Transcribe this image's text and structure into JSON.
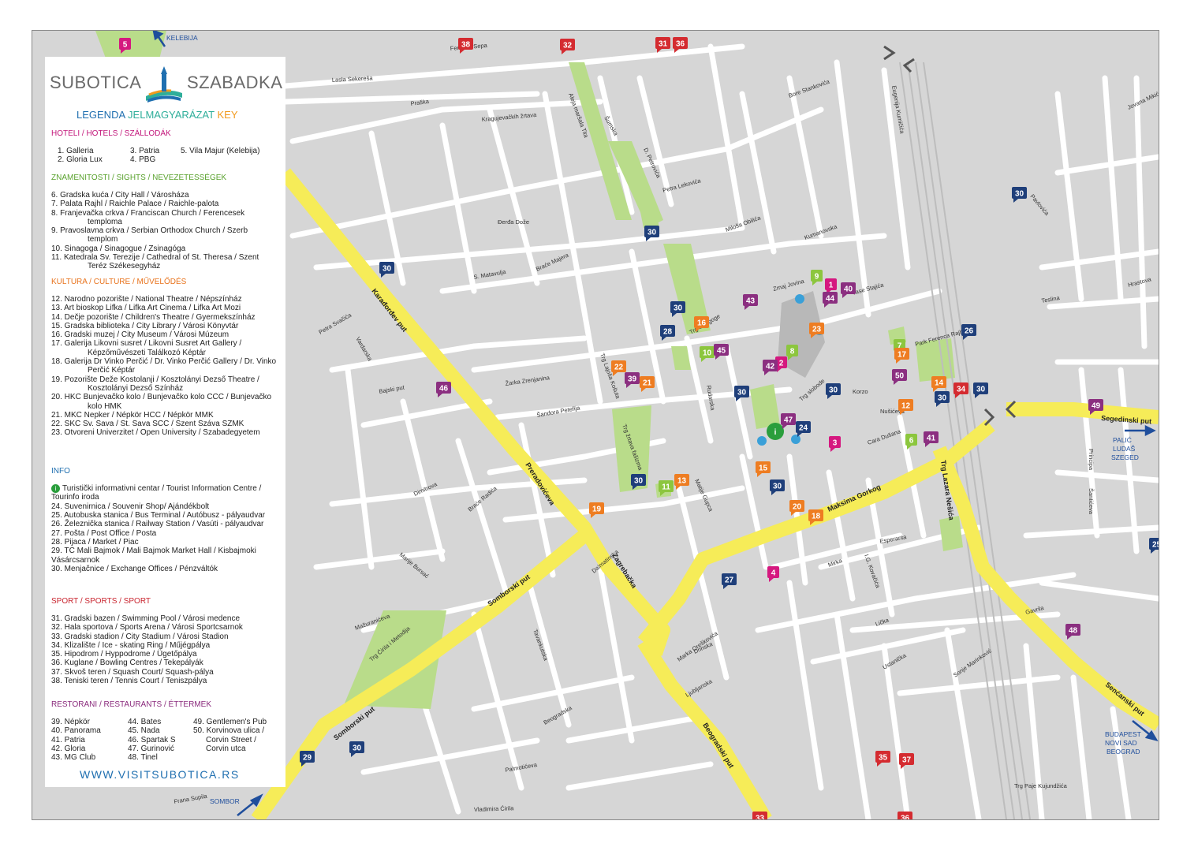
{
  "colors": {
    "road_main": "#f6ec58",
    "road_secondary": "#ffffff",
    "block": "#d6d6d6",
    "park": "#b9dc8a",
    "hotel": "#d5187f",
    "sight": "#8cc63e",
    "culture": "#ee7d22",
    "info": "#1f3f7a",
    "sport": "#d42b30",
    "restaurant": "#8b2f80"
  },
  "legend": {
    "logo_left": "SUBOTICA",
    "logo_right": "SZABADKA",
    "heading": {
      "a": "LEGENDA",
      "b": "JELMAGYARÁZAT",
      "c": "KEY"
    },
    "hotels_title": "HOTELI / HOTELS / SZÁLLODÁK",
    "hotels_col1": [
      "1. Galleria",
      "2. Gloria Lux"
    ],
    "hotels_col2": [
      "3. Patria",
      "4. PBG"
    ],
    "hotels_col3": [
      "5. Vila Majur (Kelebija)"
    ],
    "sights_title": "ZNAMENITOSTI / SIGHTS / NEVEZETESSÉGEK",
    "sights": [
      "6. Gradska kuća / City Hall / Városháza",
      "7. Palata Rajhl / Raichle Palace / Raichle-palota",
      "8. Franjevačka crkva / Franciscan Church / Ferencesek temploma",
      "9. Pravoslavna crkva / Serbian Orthodox Church / Szerb templom",
      "10. Sinagoga / Sinagogue / Zsinagóga",
      "11. Katedrala Sv. Terezije / Cathedral of St. Theresa / Szent Teréz Székesegyház"
    ],
    "culture_title": "KULTURA / CULTURE / MŰVELŐDÉS",
    "culture": [
      "12. Narodno pozorište / National Theatre / Népszínház",
      "13. Art bioskop Lifka / Lifka Art Cinema / Lifka Art Mozi",
      "14. Dečje pozorište / Children's Theatre / Gyermekszínház",
      "15. Gradska biblioteka / City Library / Városi Könyvtár",
      "16. Gradski muzej / City Museum / Városi Múzeum",
      "17. Galerija Likovni susret / Likovni Susret Art Gallery / Képzőművészeti Találkozó Képtár",
      "18. Galerija Dr Vinko Perčić / Dr. Vinko Perčić Gallery / Dr. Vinko Perčić Képtár",
      "19. Pozorište Deže Kostolanji / Kosztolányi Dezső Theatre / Kosztolányi Dezső Színház",
      "20. HKC Bunjevačko kolo / Bunjevačko kolo CCC / Bunjevačko kolo HMK",
      "21. MKC Nepker / Népkör HCC / Népkör MMK",
      "22. SKC Sv. Sava / St. Sava SCC / Szent Száva SZMK",
      "23. Otvoreni Univerzitet / Open University / Szabadegyetem"
    ],
    "info_title": "INFO",
    "info": [
      "Turistički informativni centar / Tourist Information Centre / Tourinfo iroda",
      "24. Suvenirnica / Souvenir Shop/ Ajándékbolt",
      "25. Autobuska stanica / Bus Terminal / Autóbusz - pályaudvar",
      "26. Železnička stanica / Railway Station / Vasúti - pályaudvar",
      "27. Pošta / Post Office / Posta",
      "28. Pijaca / Market / Piac",
      "29. TC Mali Bajmok / Mali Bajmok Market Hall / Kisbajmoki Vásárcsarnok",
      "30. Menjačnice / Exchange Offices / Pénzváltók"
    ],
    "sport_title": "SPORT / SPORTS / SPORT",
    "sport": [
      "31. Gradski bazen / Swimming Pool / Városi medence",
      "32. Hala sportova / Sports Arena / Városi Sportcsarnok",
      "33. Gradski stadion / City Stadium / Városi Stadion",
      "34. Klizalište / Ice - skating Ring / Műjégpálya",
      "35. Hipodrom / Hyppodrome / Ügetőpálya",
      "36. Kuglane / Bowling Centres / Tekepályák",
      "37. Skvoš teren / Squash Court/ Squash-pálya",
      "38. Teniski teren / Tennis Court / Teniszpálya"
    ],
    "rest_title": "RESTORANI / RESTAURANTS / ÉTTERMEK",
    "rest_col1": [
      "39. Népkör",
      "40. Panorama",
      "41. Patria",
      "42. Gloria",
      "43. MG Club"
    ],
    "rest_col2": [
      "44. Bates",
      "45. Nada",
      "46. Spartak S",
      "47. Gurinović",
      "48. Tinel"
    ],
    "rest_col3": [
      "49. Gentlemen's Pub",
      "50. Korvinova ulica /",
      "Corvin Street /",
      "Corvin utca"
    ],
    "website": "WWW.VISITSUBOTICA.RS"
  },
  "map": {
    "destinations": [
      "KELEBIJA",
      "SOMBOR",
      "PALIĆ",
      "LUDAŠ",
      "SZEGED",
      "BUDAPEST",
      "NOVI SAD",
      "BEOGRAD"
    ],
    "main_roads": [
      "Karađorđev put",
      "Preradovićeva",
      "Zagrebačka",
      "Somborski put",
      "Somborski put",
      "Beogradski put",
      "Maksima Gorkog",
      "Trg Lazara Nešića",
      "Senćanski put",
      "Segedinski put"
    ],
    "streets": [
      "Ferenca Sepa",
      "Lasla Sekereša",
      "Praška",
      "Kragujevačkih žrtava",
      "Aleja maršala Tita",
      "Šumska",
      "D. Petrovića",
      "Petra Lekovića",
      "Miloša Obilića",
      "Bore Stankovića",
      "Kumanovska",
      "Zmaj Jovina",
      "Vase Stajića",
      "Korzo",
      "Nušićeva",
      "Cara Dušana",
      "Đerđa Dože",
      "S. Matavulja",
      "Braće Majera",
      "Žarka Zrenjanina",
      "Šandora Petefija",
      "Petra Svačića",
      "Bajski put",
      "Vardarska",
      "Matije Gupca",
      "Drinska",
      "Marka Oreškovića",
      "Ljubljanska",
      "Ustanička",
      "Sonje Marinković",
      "Eugenija Kumičića",
      "Jovana Mikića",
      "Hrastova",
      "Teslina",
      "Šantićeva",
      "Principa",
      "Gavrila",
      "Lička",
      "Mirka",
      "Esperanta",
      "I.G. Kovačića",
      "Braće Radića",
      "Mažuranićeva",
      "Marije Bursać",
      "Beogradska",
      "Palmotićeva",
      "Vladimira Ćirila",
      "Frana Supila",
      "Trg Ćirila i Metodija",
      "Trg slobode",
      "Trg žrtava fašizma",
      "Trg Lajoša Košuta",
      "Trg sinagoge",
      "Park Ferenca Rajhla",
      "Trg Paje Kujundžića",
      "Pavlovića",
      "Rudarska",
      "Dimitrova",
      "Tavankutska",
      "Dalmatinska"
    ],
    "markers": [
      {
        "n": "5",
        "c": "hotel"
      },
      {
        "n": "38",
        "c": "sport"
      },
      {
        "n": "32",
        "c": "sport"
      },
      {
        "n": "31",
        "c": "sport"
      },
      {
        "n": "36",
        "c": "sport"
      },
      {
        "n": "30",
        "c": "info"
      },
      {
        "n": "30",
        "c": "info"
      },
      {
        "n": "30",
        "c": "info"
      },
      {
        "n": "28",
        "c": "info"
      },
      {
        "n": "16",
        "c": "culture"
      },
      {
        "n": "10",
        "c": "sight"
      },
      {
        "n": "45",
        "c": "restaurant"
      },
      {
        "n": "43",
        "c": "restaurant"
      },
      {
        "n": "9",
        "c": "sight"
      },
      {
        "n": "1",
        "c": "hotel"
      },
      {
        "n": "40",
        "c": "restaurant"
      },
      {
        "n": "44",
        "c": "restaurant"
      },
      {
        "n": "23",
        "c": "culture"
      },
      {
        "n": "8",
        "c": "sight"
      },
      {
        "n": "2",
        "c": "hotel"
      },
      {
        "n": "42",
        "c": "restaurant"
      },
      {
        "n": "7",
        "c": "sight"
      },
      {
        "n": "17",
        "c": "culture"
      },
      {
        "n": "26",
        "c": "info"
      },
      {
        "n": "50",
        "c": "restaurant"
      },
      {
        "n": "14",
        "c": "culture"
      },
      {
        "n": "34",
        "c": "sport"
      },
      {
        "n": "30",
        "c": "info"
      },
      {
        "n": "30",
        "c": "info"
      },
      {
        "n": "30",
        "c": "info"
      },
      {
        "n": "12",
        "c": "culture"
      },
      {
        "n": "30",
        "c": "info"
      },
      {
        "n": "22",
        "c": "culture"
      },
      {
        "n": "39",
        "c": "restaurant"
      },
      {
        "n": "21",
        "c": "culture"
      },
      {
        "n": "46",
        "c": "restaurant"
      },
      {
        "n": "47",
        "c": "restaurant"
      },
      {
        "n": "24",
        "c": "info"
      },
      {
        "n": "6",
        "c": "sight"
      },
      {
        "n": "41",
        "c": "restaurant"
      },
      {
        "n": "3",
        "c": "hotel"
      },
      {
        "n": "15",
        "c": "culture"
      },
      {
        "n": "30",
        "c": "info"
      },
      {
        "n": "30",
        "c": "info"
      },
      {
        "n": "11",
        "c": "sight"
      },
      {
        "n": "13",
        "c": "culture"
      },
      {
        "n": "19",
        "c": "culture"
      },
      {
        "n": "20",
        "c": "culture"
      },
      {
        "n": "18",
        "c": "culture"
      },
      {
        "n": "27",
        "c": "info"
      },
      {
        "n": "4",
        "c": "hotel"
      },
      {
        "n": "48",
        "c": "restaurant"
      },
      {
        "n": "25",
        "c": "info"
      },
      {
        "n": "49",
        "c": "restaurant"
      },
      {
        "n": "30",
        "c": "info"
      },
      {
        "n": "29",
        "c": "info"
      },
      {
        "n": "35",
        "c": "sport"
      },
      {
        "n": "37",
        "c": "sport"
      },
      {
        "n": "33",
        "c": "sport"
      },
      {
        "n": "36",
        "c": "sport"
      },
      {
        "n": "30",
        "c": "info"
      }
    ]
  }
}
